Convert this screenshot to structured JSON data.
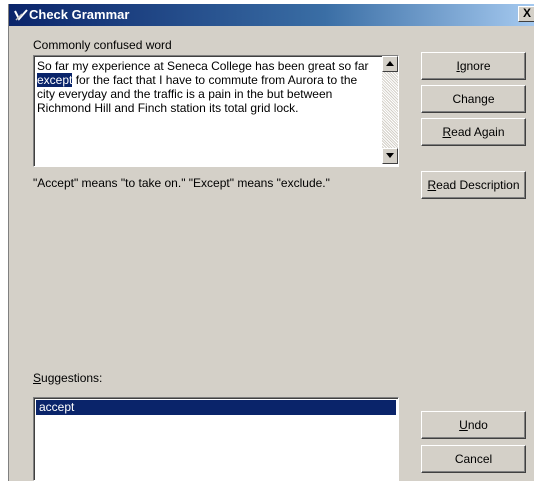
{
  "window": {
    "title": "Check Grammar",
    "close_label": "X"
  },
  "labels": {
    "confused_word": "Commonly confused word",
    "description": "\"Accept\" means \"to take on.\" \"Except\" means \"exclude.\"",
    "suggestions_prefix": "S",
    "suggestions_rest": "uggestions:"
  },
  "text": {
    "before": "So far my experience at Seneca College has been great so far ",
    "highlight": "except",
    "after": " for the fact that I have to commute from Aurora to the city everyday and the traffic is a pain in the but between Richmond Hill and Finch station its total grid lock."
  },
  "buttons": {
    "ignore": {
      "mnemonic": "I",
      "rest": "gnore"
    },
    "change": {
      "label": "Change"
    },
    "read_again": {
      "mnemonic": "R",
      "rest": "ead Again"
    },
    "read_description": {
      "mnemonic": "R",
      "rest": "ead Description"
    },
    "undo": {
      "mnemonic": "U",
      "rest": "ndo"
    },
    "cancel": {
      "label": "Cancel"
    }
  },
  "suggestions": {
    "items": [
      "accept"
    ],
    "selected_index": 0
  },
  "colors": {
    "selection": "#0a246a",
    "face": "#d4d0c8"
  }
}
